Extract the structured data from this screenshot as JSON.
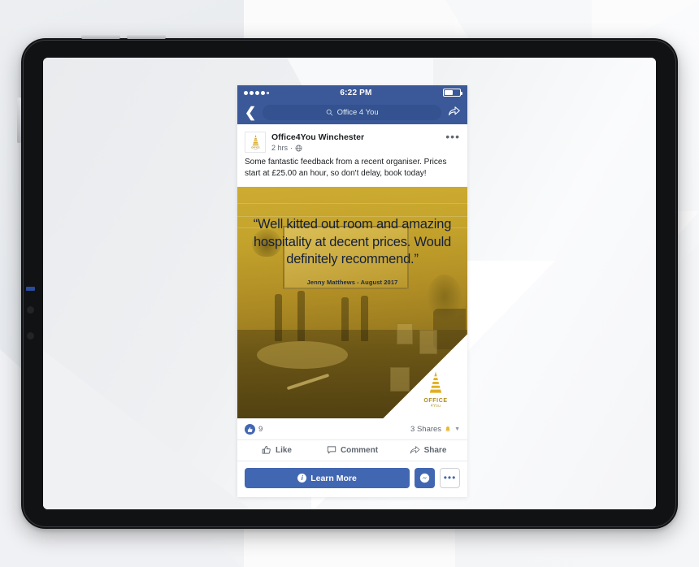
{
  "device": {
    "type": "tablet"
  },
  "statusbar": {
    "signal_bars_filled": 4,
    "signal_bars_total": 5,
    "time": "6:22 PM",
    "battery_percent": 55
  },
  "navbar": {
    "back_icon": "chevron-left-icon",
    "search_icon": "search-icon",
    "search_value": "Office 4 You",
    "share_icon": "share-arrow-icon"
  },
  "post": {
    "avatar_icon": "office4you-logo-icon",
    "page_name": "Office4You Winchester",
    "timestamp": "2 hrs",
    "separator": "·",
    "privacy_icon": "globe-icon",
    "menu_icon": "more-options-icon",
    "body": "Some fantastic feedback from a recent organiser. Prices start at £25.00 an hour, so don't delay, book today!"
  },
  "creative": {
    "quote": "“Well kitted out room and amazing hospitality at decent prices. Would definitely recommend.”",
    "attribution": "Jenny Matthews - August 2017",
    "logo_word": "OFFICE",
    "logo_sub": "4You",
    "tint_color": "#c9a227",
    "quote_color": "#14203a"
  },
  "engagement": {
    "reaction_icon": "thumbs-up-icon",
    "like_count": "9",
    "shares_label": "3 Shares",
    "bell_icon": "bell-icon",
    "caret_icon": "chevron-down-icon"
  },
  "actions": [
    {
      "icon": "thumbs-up-outline-icon",
      "label": "Like"
    },
    {
      "icon": "comment-bubble-icon",
      "label": "Comment"
    },
    {
      "icon": "share-arrow-icon",
      "label": "Share"
    }
  ],
  "cta": {
    "info_icon": "info-icon",
    "primary_label": "Learn More",
    "messenger_icon": "messenger-icon",
    "more_icon": "more-options-icon",
    "more_label": "•••",
    "accent_color": "#4267b2"
  },
  "colors": {
    "facebook_blue": "#3b5998",
    "button_blue": "#4267b2",
    "gold": "#c9a227"
  }
}
